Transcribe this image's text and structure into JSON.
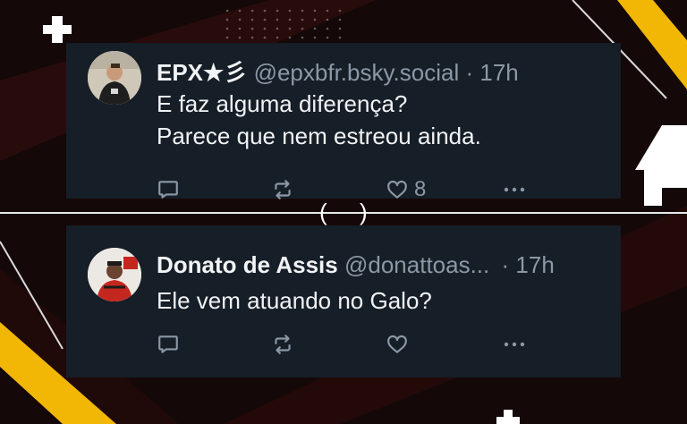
{
  "replies": [
    {
      "display_name": "EPX★彡",
      "handle": "@epxbfr.bsky.social",
      "separator": "·",
      "time": "17h",
      "text_lines": [
        "E faz alguma diferença?",
        "Parece que nem estreou ainda."
      ],
      "actions": {
        "reply_count": "",
        "repost_count": "",
        "like_count": "8"
      }
    },
    {
      "display_name": "Donato de Assis",
      "handle": "@donattoas...",
      "separator": "·",
      "time": "17h",
      "text_lines": [
        "Ele vem atuando no Galo?"
      ],
      "actions": {
        "reply_count": "",
        "repost_count": "",
        "like_count": ""
      }
    }
  ],
  "icons": [
    "reply-icon",
    "repost-icon",
    "like-icon",
    "more-icon"
  ],
  "divider_marks": {
    "left": "(",
    "right": ")"
  },
  "colors": {
    "background": "#120707",
    "card": "#161e27",
    "text": "#f1f3f5",
    "muted": "#8b98a5",
    "accent": "#f2b705"
  }
}
